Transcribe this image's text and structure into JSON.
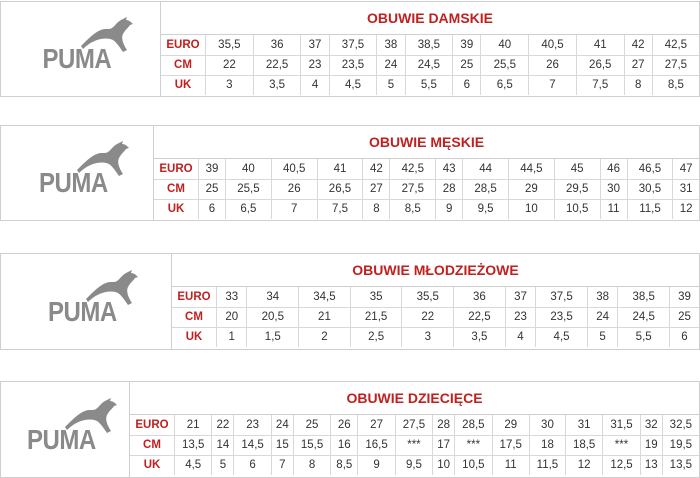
{
  "brand": {
    "logo_text": "PUMA",
    "accent_color": "#c21f1f"
  },
  "tables": [
    {
      "title": "OBUWIE DAMSKIE",
      "rows": [
        {
          "label": "EURO",
          "values": [
            "35,5",
            "36",
            "37",
            "37,5",
            "38",
            "38,5",
            "39",
            "40",
            "40,5",
            "41",
            "42",
            "42,5"
          ]
        },
        {
          "label": "CM",
          "values": [
            "22",
            "22,5",
            "23",
            "23,5",
            "24",
            "24,5",
            "25",
            "25,5",
            "26",
            "26,5",
            "27",
            "27,5"
          ]
        },
        {
          "label": "UK",
          "values": [
            "3",
            "3,5",
            "4",
            "4,5",
            "5",
            "5,5",
            "6",
            "6,5",
            "7",
            "7,5",
            "8",
            "8,5"
          ]
        }
      ]
    },
    {
      "title": "OBUWIE MĘSKIE",
      "rows": [
        {
          "label": "EURO",
          "values": [
            "39",
            "40",
            "40,5",
            "41",
            "42",
            "42,5",
            "43",
            "44",
            "44,5",
            "45",
            "46",
            "46,5",
            "47"
          ]
        },
        {
          "label": "CM",
          "values": [
            "25",
            "25,5",
            "26",
            "26,5",
            "27",
            "27,5",
            "28",
            "28,5",
            "29",
            "29,5",
            "30",
            "30,5",
            "31"
          ]
        },
        {
          "label": "UK",
          "values": [
            "6",
            "6,5",
            "7",
            "7,5",
            "8",
            "8,5",
            "9",
            "9,5",
            "10",
            "10,5",
            "11",
            "11,5",
            "12"
          ]
        }
      ]
    },
    {
      "title": "OBUWIE MŁODZIEŻOWE",
      "rows": [
        {
          "label": "EURO",
          "values": [
            "33",
            "34",
            "34,5",
            "35",
            "35,5",
            "36",
            "37",
            "37,5",
            "38",
            "38,5",
            "39"
          ]
        },
        {
          "label": "CM",
          "values": [
            "20",
            "20,5",
            "21",
            "21,5",
            "22",
            "22,5",
            "23",
            "23,5",
            "24",
            "24,5",
            "25"
          ]
        },
        {
          "label": "UK",
          "values": [
            "1",
            "1,5",
            "2",
            "2,5",
            "3",
            "3,5",
            "4",
            "4,5",
            "5",
            "5,5",
            "6"
          ]
        }
      ]
    },
    {
      "title": "OBUWIE DZIECIĘCE",
      "rows": [
        {
          "label": "EURO",
          "values": [
            "21",
            "22",
            "23",
            "24",
            "25",
            "26",
            "27",
            "27,5",
            "28",
            "28,5",
            "29",
            "30",
            "31",
            "31,5",
            "32",
            "32,5"
          ]
        },
        {
          "label": "CM",
          "values": [
            "13,5",
            "14",
            "14,5",
            "15",
            "15,5",
            "16",
            "16,5",
            "***",
            "17",
            "***",
            "17,5",
            "18",
            "18,5",
            "***",
            "19",
            "19,5"
          ]
        },
        {
          "label": "UK",
          "values": [
            "4,5",
            "5",
            "6",
            "7",
            "8",
            "8,5",
            "9",
            "9,5",
            "10",
            "10,5",
            "11",
            "11,5",
            "12",
            "12,5",
            "13",
            "13,5"
          ]
        }
      ]
    }
  ]
}
